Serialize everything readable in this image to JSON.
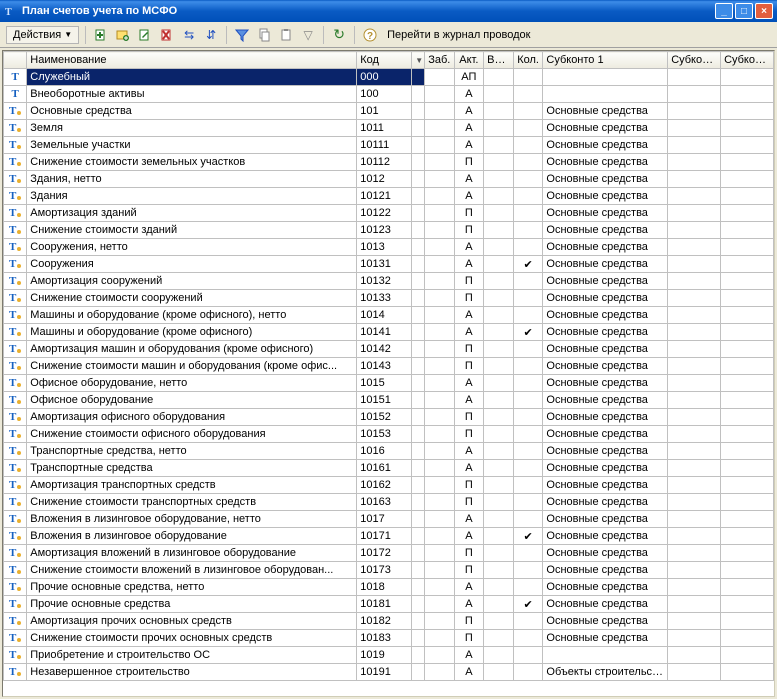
{
  "window": {
    "title": "План счетов учета по МСФО"
  },
  "toolbar": {
    "actions_label": "Действия",
    "link_label": "Перейти в журнал проводок"
  },
  "columns": {
    "name": "Наименование",
    "code": "Код",
    "zab": "Заб.",
    "akt": "Акт.",
    "val": "Вал.",
    "kol": "Кол.",
    "sub1": "Субконто 1",
    "sub2": "Субкон...",
    "sub3": "Субкон..."
  },
  "rows": [
    {
      "lvl": 0,
      "name": "Служебный",
      "code": "000",
      "akt": "АП",
      "kol": "",
      "sub1": "",
      "selected": true
    },
    {
      "lvl": 0,
      "name": "Внеоборотные активы",
      "code": "100",
      "akt": "А",
      "kol": "",
      "sub1": ""
    },
    {
      "lvl": 1,
      "name": "Основные средства",
      "code": "101",
      "akt": "А",
      "kol": "",
      "sub1": "Основные средства"
    },
    {
      "lvl": 1,
      "name": "Земля",
      "code": "1011",
      "akt": "А",
      "kol": "",
      "sub1": "Основные средства"
    },
    {
      "lvl": 1,
      "name": "Земельные участки",
      "code": "10111",
      "akt": "А",
      "kol": "",
      "sub1": "Основные средства"
    },
    {
      "lvl": 1,
      "name": "Снижение стоимости земельных участков",
      "code": "10112",
      "akt": "П",
      "kol": "",
      "sub1": "Основные средства"
    },
    {
      "lvl": 1,
      "name": "Здания, нетто",
      "code": "1012",
      "akt": "А",
      "kol": "",
      "sub1": "Основные средства"
    },
    {
      "lvl": 1,
      "name": "Здания",
      "code": "10121",
      "akt": "А",
      "kol": "",
      "sub1": "Основные средства"
    },
    {
      "lvl": 1,
      "name": "Амортизация зданий",
      "code": "10122",
      "akt": "П",
      "kol": "",
      "sub1": "Основные средства"
    },
    {
      "lvl": 1,
      "name": "Снижение стоимости зданий",
      "code": "10123",
      "akt": "П",
      "kol": "",
      "sub1": "Основные средства"
    },
    {
      "lvl": 1,
      "name": "Сооружения, нетто",
      "code": "1013",
      "akt": "А",
      "kol": "",
      "sub1": "Основные средства"
    },
    {
      "lvl": 1,
      "name": "Сооружения",
      "code": "10131",
      "akt": "А",
      "kol": "✔",
      "sub1": "Основные средства"
    },
    {
      "lvl": 1,
      "name": "Амортизация сооружений",
      "code": "10132",
      "akt": "П",
      "kol": "",
      "sub1": "Основные средства"
    },
    {
      "lvl": 1,
      "name": "Снижение стоимости сооружений",
      "code": "10133",
      "akt": "П",
      "kol": "",
      "sub1": "Основные средства"
    },
    {
      "lvl": 1,
      "name": "Машины и оборудование (кроме офисного), нетто",
      "code": "1014",
      "akt": "А",
      "kol": "",
      "sub1": "Основные средства"
    },
    {
      "lvl": 1,
      "name": "Машины и оборудование (кроме офисного)",
      "code": "10141",
      "akt": "А",
      "kol": "✔",
      "sub1": "Основные средства"
    },
    {
      "lvl": 1,
      "name": "Амортизация машин и оборудования (кроме офисного)",
      "code": "10142",
      "akt": "П",
      "kol": "",
      "sub1": "Основные средства"
    },
    {
      "lvl": 1,
      "name": "Снижение стоимости машин и оборудования (кроме офис...",
      "code": "10143",
      "akt": "П",
      "kol": "",
      "sub1": "Основные средства"
    },
    {
      "lvl": 1,
      "name": "Офисное оборудование, нетто",
      "code": "1015",
      "akt": "А",
      "kol": "",
      "sub1": "Основные средства"
    },
    {
      "lvl": 1,
      "name": "Офисное оборудование",
      "code": "10151",
      "akt": "А",
      "kol": "",
      "sub1": "Основные средства"
    },
    {
      "lvl": 1,
      "name": "Амортизация офисного оборудования",
      "code": "10152",
      "akt": "П",
      "kol": "",
      "sub1": "Основные средства"
    },
    {
      "lvl": 1,
      "name": "Снижение стоимости офисного оборудования",
      "code": "10153",
      "akt": "П",
      "kol": "",
      "sub1": "Основные средства"
    },
    {
      "lvl": 1,
      "name": "Транспортные средства, нетто",
      "code": "1016",
      "akt": "А",
      "kol": "",
      "sub1": "Основные средства"
    },
    {
      "lvl": 1,
      "name": "Транспортные средства",
      "code": "10161",
      "akt": "А",
      "kol": "",
      "sub1": "Основные средства"
    },
    {
      "lvl": 1,
      "name": "Амортизация транспортных средств",
      "code": "10162",
      "akt": "П",
      "kol": "",
      "sub1": "Основные средства"
    },
    {
      "lvl": 1,
      "name": "Снижение стоимости транспортных средств",
      "code": "10163",
      "akt": "П",
      "kol": "",
      "sub1": "Основные средства"
    },
    {
      "lvl": 1,
      "name": "Вложения в лизинговое оборудование, нетто",
      "code": "1017",
      "akt": "А",
      "kol": "",
      "sub1": "Основные средства"
    },
    {
      "lvl": 1,
      "name": "Вложения в лизинговое оборудование",
      "code": "10171",
      "akt": "А",
      "kol": "✔",
      "sub1": "Основные средства"
    },
    {
      "lvl": 1,
      "name": "Амортизация вложений в лизинговое оборудование",
      "code": "10172",
      "akt": "П",
      "kol": "",
      "sub1": "Основные средства"
    },
    {
      "lvl": 1,
      "name": "Снижение стоимости вложений в лизинговое оборудован...",
      "code": "10173",
      "akt": "П",
      "kol": "",
      "sub1": "Основные средства"
    },
    {
      "lvl": 1,
      "name": "Прочие основные средства, нетто",
      "code": "1018",
      "akt": "А",
      "kol": "",
      "sub1": "Основные средства"
    },
    {
      "lvl": 1,
      "name": "Прочие основные средства",
      "code": "10181",
      "akt": "А",
      "kol": "✔",
      "sub1": "Основные средства"
    },
    {
      "lvl": 1,
      "name": "Амортизация прочих основных средств",
      "code": "10182",
      "akt": "П",
      "kol": "",
      "sub1": "Основные средства"
    },
    {
      "lvl": 1,
      "name": "Снижение стоимости прочих основных средств",
      "code": "10183",
      "akt": "П",
      "kol": "",
      "sub1": "Основные средства"
    },
    {
      "lvl": 1,
      "name": "Приобретение и строительство  ОС",
      "code": "1019",
      "akt": "А",
      "kol": "",
      "sub1": ""
    },
    {
      "lvl": 1,
      "name": "Незавершенное строительство",
      "code": "10191",
      "akt": "А",
      "kol": "",
      "sub1": "Объекты строительства"
    }
  ]
}
